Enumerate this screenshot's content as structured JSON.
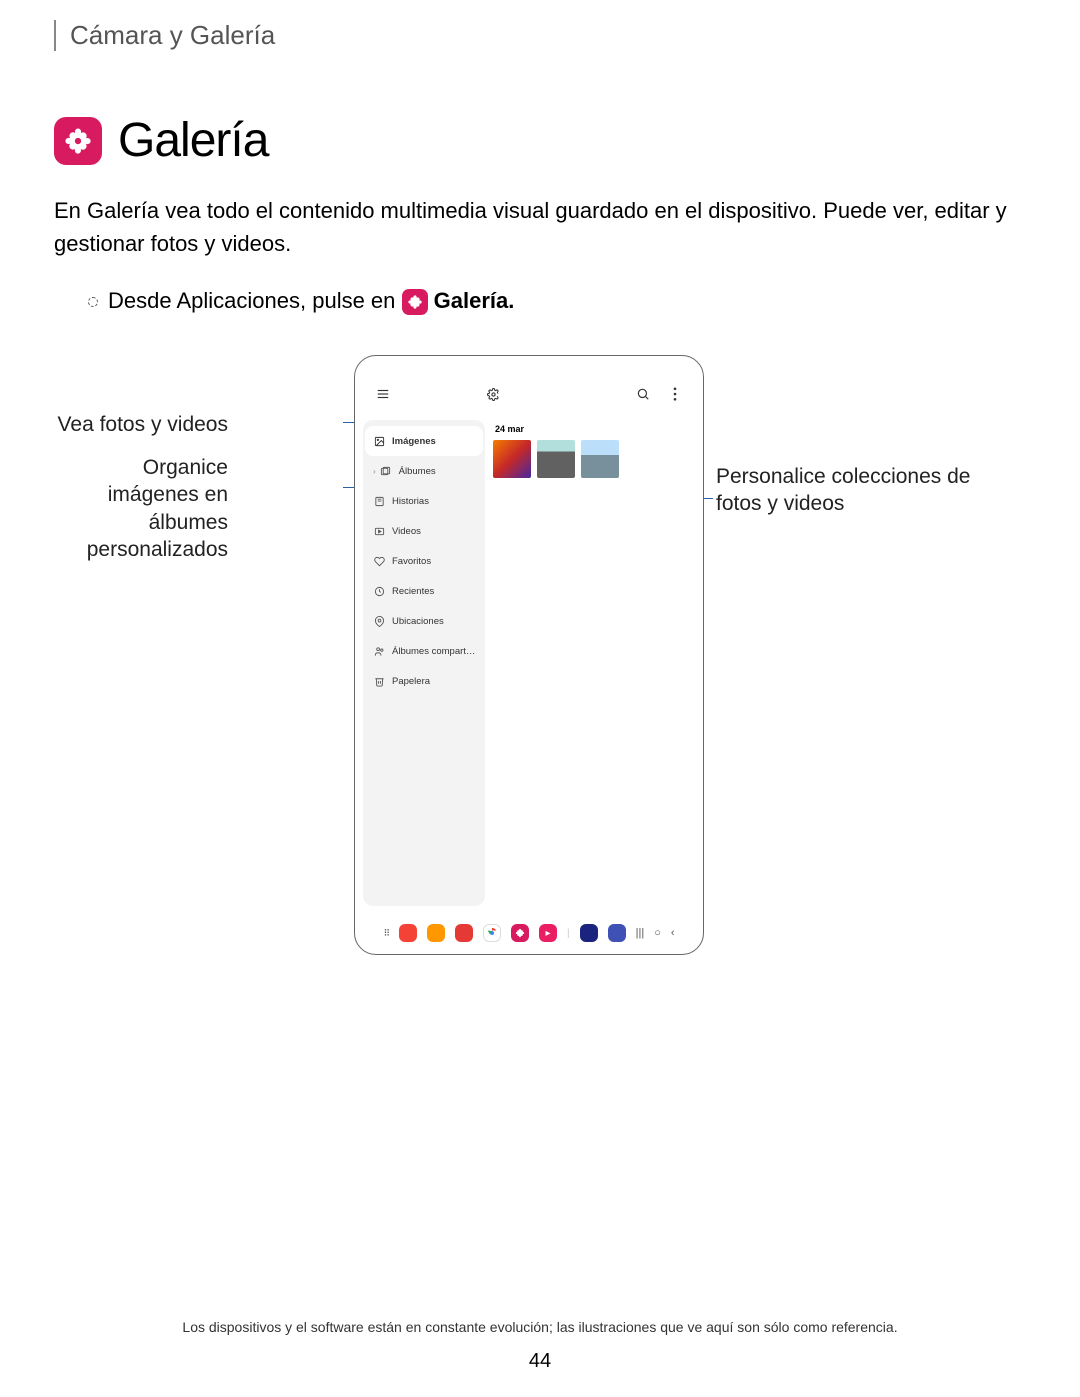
{
  "breadcrumb": "Cámara y Galería",
  "title": "Galería",
  "intro": "En Galería vea todo el contenido multimedia visual guardado en el dispositivo. Puede ver, editar y gestionar fotos y videos.",
  "instruction_prefix": "Desde Aplicaciones, pulse en ",
  "instruction_app": "Galería.",
  "callouts": {
    "left1": "Vea fotos y videos",
    "left2": "Organice imágenes en álbumes personalizados",
    "right1": "Personalice colecciones de fotos y videos"
  },
  "phone": {
    "date": "24 mar",
    "sidebar": [
      "Imágenes",
      "Álbumes",
      "Historias",
      "Videos",
      "Favoritos",
      "Recientes",
      "Ubicaciones",
      "Álbumes compart…",
      "Papelera"
    ]
  },
  "disclaimer": "Los dispositivos y el software están en constante evolución; las ilustraciones que ve aquí son sólo como referencia.",
  "page_number": "44"
}
